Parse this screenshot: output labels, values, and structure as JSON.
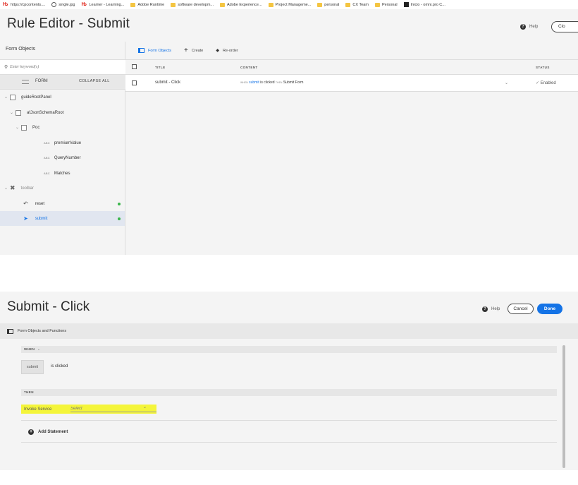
{
  "bookmarks": [
    {
      "label": "https://cpcontents....",
      "icon": "adobe-icon"
    },
    {
      "label": "single.jpg",
      "icon": "globe-icon"
    },
    {
      "label": "Learner - Learning...",
      "icon": "adobe-icon"
    },
    {
      "label": "Adobe Runtime",
      "icon": "folder-icon"
    },
    {
      "label": "software developm...",
      "icon": "folder-icon"
    },
    {
      "label": "Adobe Experience...",
      "icon": "folder-icon"
    },
    {
      "label": "Project Manageme...",
      "icon": "folder-icon"
    },
    {
      "label": "personal",
      "icon": "folder-icon"
    },
    {
      "label": "CX Team",
      "icon": "folder-icon"
    },
    {
      "label": "Personal",
      "icon": "folder-icon"
    },
    {
      "label": "Inicio - omni.pro C...",
      "icon": "omni-icon"
    }
  ],
  "top_editor": {
    "title": "Rule Editor - Submit",
    "help_label": "Help",
    "close_label": "Clo",
    "left_panel": {
      "title": "Form Objects",
      "search_placeholder": "Enter keyword(s)",
      "form_label": "FORM",
      "collapse_all": "COLLAPSE ALL",
      "tree": [
        {
          "label": "guideRootPanel"
        },
        {
          "label": "afJsonSchemaRoot"
        },
        {
          "label": "Poc"
        },
        {
          "label": "premiumValue",
          "type": "ABC"
        },
        {
          "label": "QueryNumber",
          "type": "ABC"
        },
        {
          "label": "Matches",
          "type": "ABC"
        },
        {
          "label": "toolbar"
        },
        {
          "label": "reset"
        },
        {
          "label": "submit"
        }
      ]
    },
    "tabs": {
      "form_objects": "Form Objects",
      "create": "Create",
      "reorder": "Re-order"
    },
    "table": {
      "headers": {
        "title": "TITLE",
        "content": "CONTENT",
        "status": "STATUS"
      },
      "rows": [
        {
          "title": "submit - Click",
          "when_kw": "WHEN",
          "when_obj": "submit",
          "when_evt": "is clicked",
          "then_kw": "THEN",
          "then_action": "Submit Form",
          "status": "Enabled"
        }
      ]
    }
  },
  "bottom_editor": {
    "title": "Submit - Click",
    "help_label": "Help",
    "cancel_label": "Cancel",
    "done_label": "Done",
    "fof_label": "Form Objects and Functions",
    "when_label": "WHEN",
    "when_object": "submit",
    "when_event": "is clicked",
    "then_label": "THEN",
    "invoke_label": "Invoke Service",
    "select_placeholder": "Select",
    "add_statement": "Add Statement",
    "highlight_color": "#f4f53a",
    "accent_color": "#1473e6"
  }
}
